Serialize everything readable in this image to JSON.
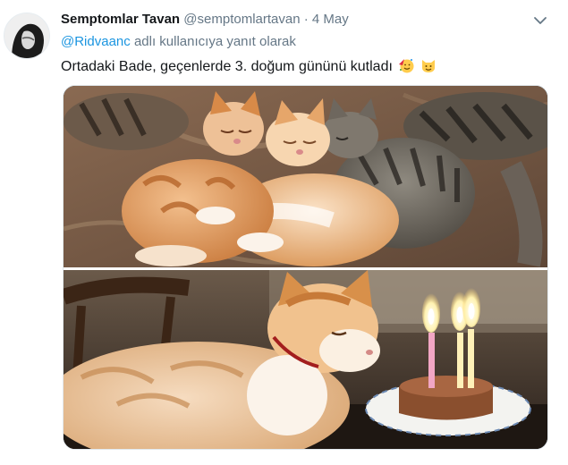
{
  "tweet": {
    "display_name": "Semptomlar Tavan",
    "handle": "@semptomlartavan",
    "separator": "·",
    "date": "4 May",
    "reply_mention": "@Ridvaanc",
    "reply_suffix": "adlı kullanıcıya yanıt olarak",
    "text": "Ortadaki Bade, geçenlerde 3. doğum gününü kutladı",
    "emojis": [
      "partying-face-emoji",
      "smiling-cat-emoji"
    ]
  },
  "colors": {
    "link": "#1b95e0",
    "secondary_text": "#657786",
    "primary_text": "#14171a"
  },
  "icons": {
    "menu": "chevron-down-icon"
  }
}
